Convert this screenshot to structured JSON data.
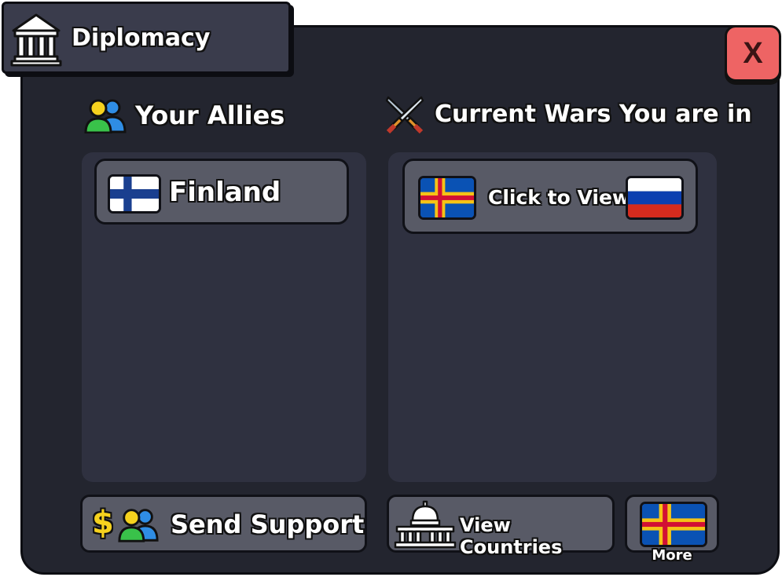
{
  "window": {
    "title": "Diplomacy",
    "close_label": "X"
  },
  "allies": {
    "heading": "Your Allies",
    "items": [
      {
        "name": "Finland",
        "flag": "finland-flag"
      }
    ]
  },
  "wars": {
    "heading": "Current Wars You are in",
    "items": [
      {
        "label": "Click to View",
        "left_flag": "aland-flag",
        "right_flag": "russia-flag"
      }
    ]
  },
  "buttons": {
    "send_support": "Send Support",
    "view_countries": "View Countries",
    "more": "More"
  },
  "colors": {
    "window_bg": "#23252f",
    "panel_bg": "#2f3140",
    "entry_bg": "#585a66",
    "close_red": "#ee6464",
    "title_tab": "#3a3c4c"
  }
}
